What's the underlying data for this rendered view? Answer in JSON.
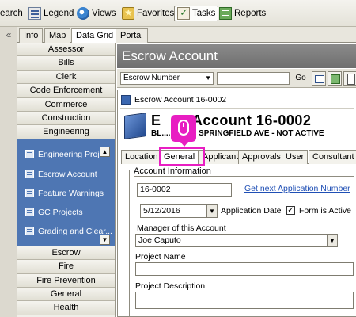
{
  "toolbar": {
    "items": [
      {
        "label": "earch",
        "icon": "search-icon"
      },
      {
        "label": "Legend",
        "icon": "legend-icon"
      },
      {
        "label": "Views",
        "icon": "globe-icon"
      },
      {
        "label": "Favorites",
        "icon": "favorites-icon"
      },
      {
        "label": "Tasks",
        "icon": "tasks-icon",
        "active": true
      },
      {
        "label": "Reports",
        "icon": "reports-icon"
      }
    ]
  },
  "left_strip": {
    "collapse_glyph": "«"
  },
  "panel_tabs": [
    "Info",
    "Map",
    "Data Grid",
    "Portal"
  ],
  "categories_top": [
    "Assessor",
    "Bills",
    "Clerk",
    "Code Enforcement",
    "Commerce",
    "Construction",
    "Engineering"
  ],
  "engineering_items": [
    "Engineering Proje",
    "Escrow Account",
    "Feature Warnings",
    "GC Projects",
    "Grading and Clear..."
  ],
  "categories_bottom": [
    "Escrow",
    "Fire",
    "Fire Prevention",
    "General",
    "Health"
  ],
  "main": {
    "header_title": "Escrow Account",
    "search_field_value": "Escrow Number",
    "go_label": "Go",
    "record_id_line": "Escrow Account 16-0002",
    "big_title": "Escrow Account  16-0002",
    "big_title_prefix": "E",
    "big_title_suffix": "w Account  16-0002",
    "big_subtitle": "BL.... 3 1170 SPRINGFIELD AVE - NOT ACTIVE",
    "form_tabs": [
      "Location",
      "General",
      "Applicant",
      "Approvals",
      "User",
      "Consultant"
    ],
    "active_form_tab": "General",
    "section_label": "Account Information",
    "account_number": "16-0002",
    "get_next_link": "Get next Application Number",
    "application_date": "5/12/2016",
    "application_date_label": "Application Date",
    "form_active_label": "Form is Active",
    "form_active_checked": true,
    "manager_label": "Manager of this Account",
    "manager_value": "Joe Caputo",
    "project_name_label": "Project Name",
    "project_name_value": "",
    "project_description_label": "Project Description",
    "project_description_value": ""
  },
  "colors": {
    "highlight": "#e81ec2",
    "sublist_bg": "#4e76b3",
    "header_bg": "#7a7a7a",
    "link": "#1f4fb5"
  }
}
